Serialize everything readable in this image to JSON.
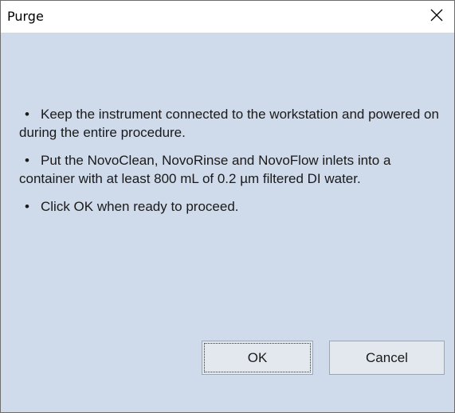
{
  "window": {
    "title": "Purge"
  },
  "message": {
    "bullet": "•",
    "lines": [
      "Keep the instrument connected to the workstation and powered on during the entire procedure.",
      "Put the NovoClean, NovoRinse and NovoFlow inlets into a container with at least 800 mL of 0.2 µm filtered DI water.",
      "Click OK when ready to proceed."
    ]
  },
  "buttons": {
    "ok_label": "OK",
    "cancel_label": "Cancel"
  },
  "icons": {
    "close": "close-icon"
  },
  "colors": {
    "dialog_bg": "#cfdaea",
    "titlebar_bg": "#ffffff",
    "button_bg": "#e3e8ef"
  }
}
